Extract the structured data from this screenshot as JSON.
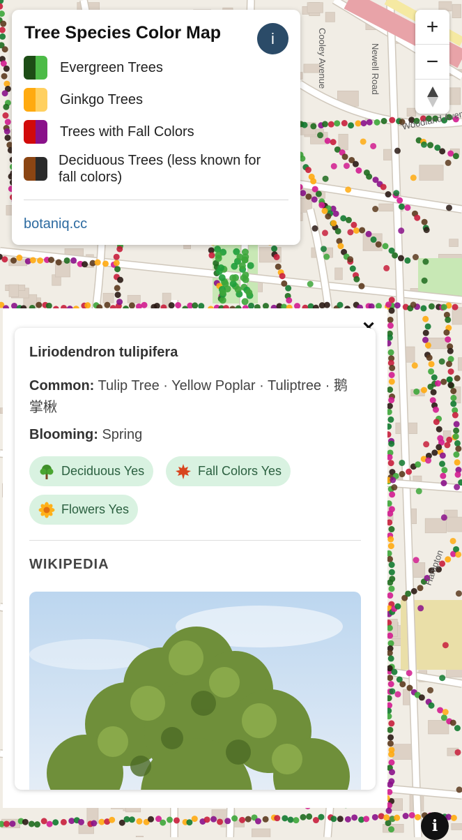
{
  "legend": {
    "title": "Tree Species Color Map",
    "info_button": "i",
    "items": [
      {
        "label": "Evergreen Trees",
        "colors": [
          "#1d4d16",
          "#4cbb47"
        ]
      },
      {
        "label": "Ginkgo Trees",
        "colors": [
          "#ffaa10",
          "#ffd060"
        ]
      },
      {
        "label": "Trees with Fall Colors",
        "colors": [
          "#d20a0a",
          "#8a118a"
        ]
      },
      {
        "label": "Deciduous Trees (less known for fall colors)",
        "colors": [
          "#8b4513",
          "#2a2a2a"
        ]
      }
    ],
    "link": "botaniq.cc"
  },
  "zoom_controls": {
    "zoom_in": "+",
    "zoom_out": "−",
    "reset_north": "▲"
  },
  "streets": [
    "Cooley Avenue",
    "Newell Road",
    "Woodland Avenue",
    "Hampton"
  ],
  "detail": {
    "close": "✕",
    "scientific_name": "Liriodendron tulipifera",
    "common_label": "Common:",
    "common_value": "Tulip Tree · Yellow Poplar · Tuliptree · 鹅掌楸",
    "blooming_label": "Blooming:",
    "blooming_value": "Spring",
    "chips": [
      {
        "icon": "🌳",
        "label": "Deciduous Yes"
      },
      {
        "icon": "🍁",
        "label": "Fall Colors Yes"
      },
      {
        "icon": "🌼",
        "label": "Flowers Yes"
      }
    ],
    "section_title": "WIKIPEDIA"
  },
  "attribution_button": "i",
  "colors": {
    "map_bg": "#f1ede5",
    "road": "#ffffff",
    "building": "#ddd1c5",
    "park": "#c8e8b5",
    "info_button": "#2b4b68",
    "chip_bg": "#d9f2e1",
    "chip_text": "#2b6040",
    "link": "#2c6aa0"
  }
}
